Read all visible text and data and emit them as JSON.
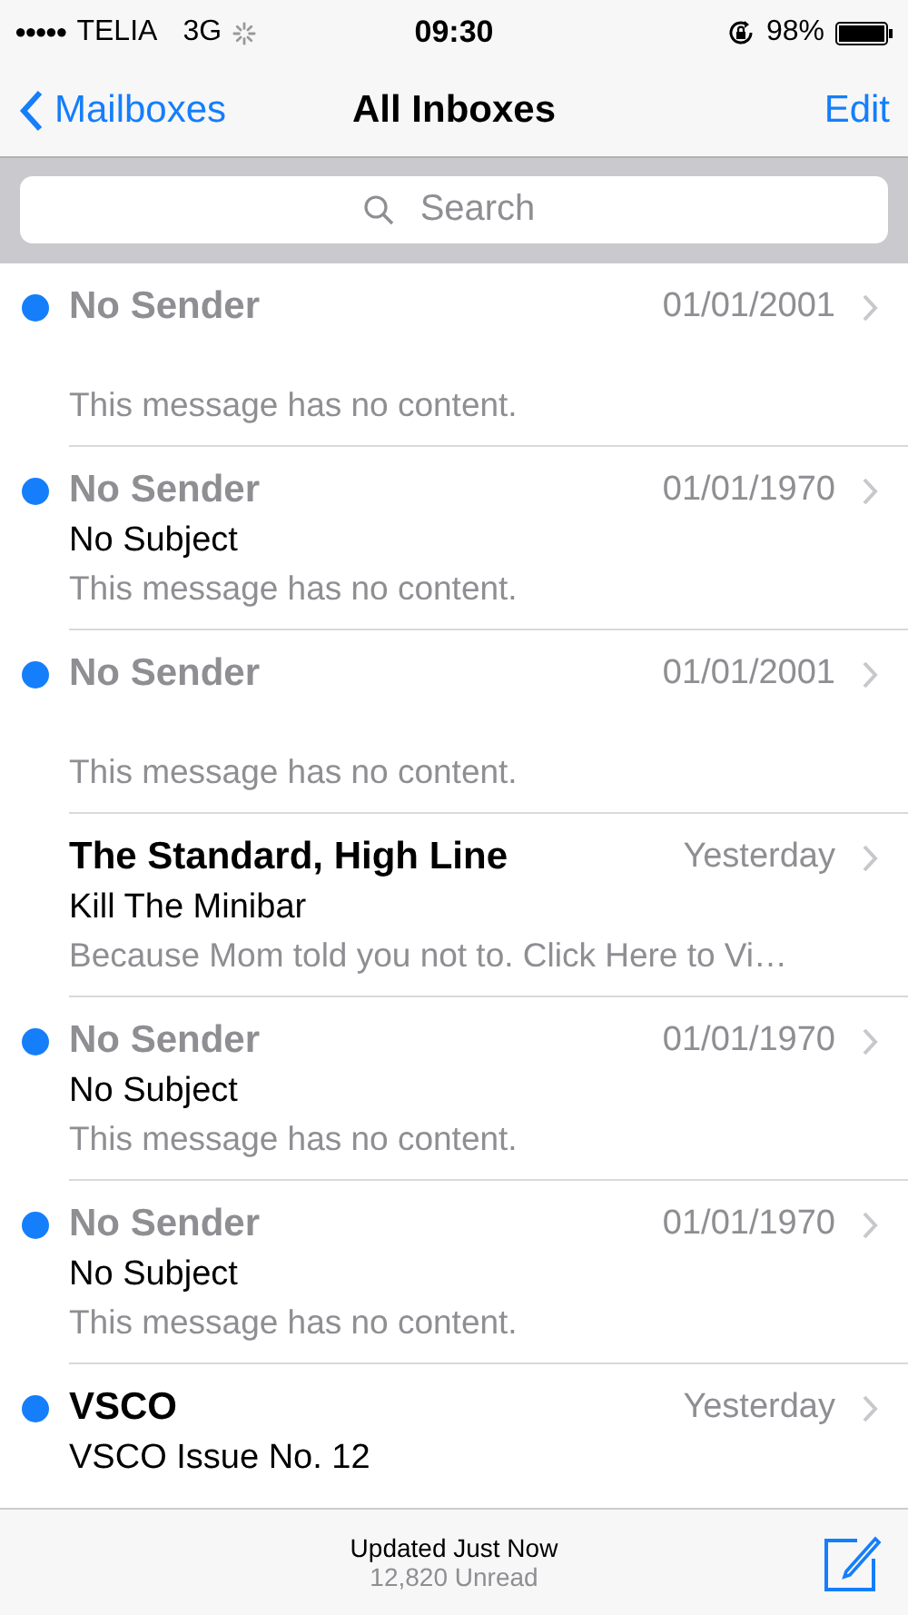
{
  "status_bar": {
    "signal_dots": "●●●●●",
    "carrier": "TELIA",
    "network": "3G",
    "time": "09:30",
    "battery": "98%"
  },
  "nav": {
    "back": "Mailboxes",
    "title": "All Inboxes",
    "action": "Edit"
  },
  "search": {
    "placeholder": "Search"
  },
  "messages": [
    {
      "sender": "No Sender",
      "sender_muted": true,
      "unread": true,
      "date": "01/01/2001",
      "preview": "This message has no content."
    },
    {
      "sender": "No Sender",
      "sender_muted": true,
      "unread": true,
      "date": "01/01/1970",
      "subject": "No Subject",
      "preview": "This message has no content."
    },
    {
      "sender": "No Sender",
      "sender_muted": true,
      "unread": true,
      "date": "01/01/2001",
      "preview": "This message has no content."
    },
    {
      "sender": "The Standard, High Line",
      "sender_muted": false,
      "unread": false,
      "date": "Yesterday",
      "subject": "Kill The Minibar",
      "preview": "Because Mom told you not to. Click Here to Vi…"
    },
    {
      "sender": "No Sender",
      "sender_muted": true,
      "unread": true,
      "date": "01/01/1970",
      "subject": "No Subject",
      "preview": "This message has no content."
    },
    {
      "sender": "No Sender",
      "sender_muted": true,
      "unread": true,
      "date": "01/01/1970",
      "subject": "No Subject",
      "preview": "This message has no content."
    },
    {
      "sender": "VSCO",
      "sender_muted": false,
      "unread": true,
      "date": "Yesterday",
      "subject": "VSCO Issue No. 12"
    }
  ],
  "toolbar": {
    "status": "Updated Just Now",
    "unread_count": "12,820 Unread"
  }
}
